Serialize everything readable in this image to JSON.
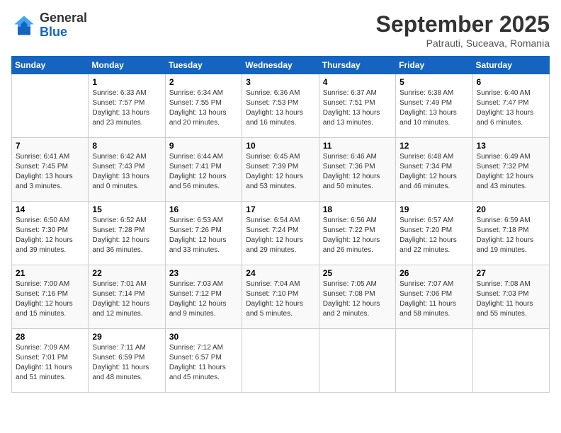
{
  "header": {
    "logo_line1": "General",
    "logo_line2": "Blue",
    "title": "September 2025",
    "subtitle": "Patrauti, Suceava, Romania"
  },
  "weekdays": [
    "Sunday",
    "Monday",
    "Tuesday",
    "Wednesday",
    "Thursday",
    "Friday",
    "Saturday"
  ],
  "weeks": [
    [
      {
        "day": "",
        "content": ""
      },
      {
        "day": "1",
        "content": "Sunrise: 6:33 AM\nSunset: 7:57 PM\nDaylight: 13 hours\nand 23 minutes."
      },
      {
        "day": "2",
        "content": "Sunrise: 6:34 AM\nSunset: 7:55 PM\nDaylight: 13 hours\nand 20 minutes."
      },
      {
        "day": "3",
        "content": "Sunrise: 6:36 AM\nSunset: 7:53 PM\nDaylight: 13 hours\nand 16 minutes."
      },
      {
        "day": "4",
        "content": "Sunrise: 6:37 AM\nSunset: 7:51 PM\nDaylight: 13 hours\nand 13 minutes."
      },
      {
        "day": "5",
        "content": "Sunrise: 6:38 AM\nSunset: 7:49 PM\nDaylight: 13 hours\nand 10 minutes."
      },
      {
        "day": "6",
        "content": "Sunrise: 6:40 AM\nSunset: 7:47 PM\nDaylight: 13 hours\nand 6 minutes."
      }
    ],
    [
      {
        "day": "7",
        "content": "Sunrise: 6:41 AM\nSunset: 7:45 PM\nDaylight: 13 hours\nand 3 minutes."
      },
      {
        "day": "8",
        "content": "Sunrise: 6:42 AM\nSunset: 7:43 PM\nDaylight: 13 hours\nand 0 minutes."
      },
      {
        "day": "9",
        "content": "Sunrise: 6:44 AM\nSunset: 7:41 PM\nDaylight: 12 hours\nand 56 minutes."
      },
      {
        "day": "10",
        "content": "Sunrise: 6:45 AM\nSunset: 7:39 PM\nDaylight: 12 hours\nand 53 minutes."
      },
      {
        "day": "11",
        "content": "Sunrise: 6:46 AM\nSunset: 7:36 PM\nDaylight: 12 hours\nand 50 minutes."
      },
      {
        "day": "12",
        "content": "Sunrise: 6:48 AM\nSunset: 7:34 PM\nDaylight: 12 hours\nand 46 minutes."
      },
      {
        "day": "13",
        "content": "Sunrise: 6:49 AM\nSunset: 7:32 PM\nDaylight: 12 hours\nand 43 minutes."
      }
    ],
    [
      {
        "day": "14",
        "content": "Sunrise: 6:50 AM\nSunset: 7:30 PM\nDaylight: 12 hours\nand 39 minutes."
      },
      {
        "day": "15",
        "content": "Sunrise: 6:52 AM\nSunset: 7:28 PM\nDaylight: 12 hours\nand 36 minutes."
      },
      {
        "day": "16",
        "content": "Sunrise: 6:53 AM\nSunset: 7:26 PM\nDaylight: 12 hours\nand 33 minutes."
      },
      {
        "day": "17",
        "content": "Sunrise: 6:54 AM\nSunset: 7:24 PM\nDaylight: 12 hours\nand 29 minutes."
      },
      {
        "day": "18",
        "content": "Sunrise: 6:56 AM\nSunset: 7:22 PM\nDaylight: 12 hours\nand 26 minutes."
      },
      {
        "day": "19",
        "content": "Sunrise: 6:57 AM\nSunset: 7:20 PM\nDaylight: 12 hours\nand 22 minutes."
      },
      {
        "day": "20",
        "content": "Sunrise: 6:59 AM\nSunset: 7:18 PM\nDaylight: 12 hours\nand 19 minutes."
      }
    ],
    [
      {
        "day": "21",
        "content": "Sunrise: 7:00 AM\nSunset: 7:16 PM\nDaylight: 12 hours\nand 15 minutes."
      },
      {
        "day": "22",
        "content": "Sunrise: 7:01 AM\nSunset: 7:14 PM\nDaylight: 12 hours\nand 12 minutes."
      },
      {
        "day": "23",
        "content": "Sunrise: 7:03 AM\nSunset: 7:12 PM\nDaylight: 12 hours\nand 9 minutes."
      },
      {
        "day": "24",
        "content": "Sunrise: 7:04 AM\nSunset: 7:10 PM\nDaylight: 12 hours\nand 5 minutes."
      },
      {
        "day": "25",
        "content": "Sunrise: 7:05 AM\nSunset: 7:08 PM\nDaylight: 12 hours\nand 2 minutes."
      },
      {
        "day": "26",
        "content": "Sunrise: 7:07 AM\nSunset: 7:06 PM\nDaylight: 11 hours\nand 58 minutes."
      },
      {
        "day": "27",
        "content": "Sunrise: 7:08 AM\nSunset: 7:03 PM\nDaylight: 11 hours\nand 55 minutes."
      }
    ],
    [
      {
        "day": "28",
        "content": "Sunrise: 7:09 AM\nSunset: 7:01 PM\nDaylight: 11 hours\nand 51 minutes."
      },
      {
        "day": "29",
        "content": "Sunrise: 7:11 AM\nSunset: 6:59 PM\nDaylight: 11 hours\nand 48 minutes."
      },
      {
        "day": "30",
        "content": "Sunrise: 7:12 AM\nSunset: 6:57 PM\nDaylight: 11 hours\nand 45 minutes."
      },
      {
        "day": "",
        "content": ""
      },
      {
        "day": "",
        "content": ""
      },
      {
        "day": "",
        "content": ""
      },
      {
        "day": "",
        "content": ""
      }
    ]
  ]
}
